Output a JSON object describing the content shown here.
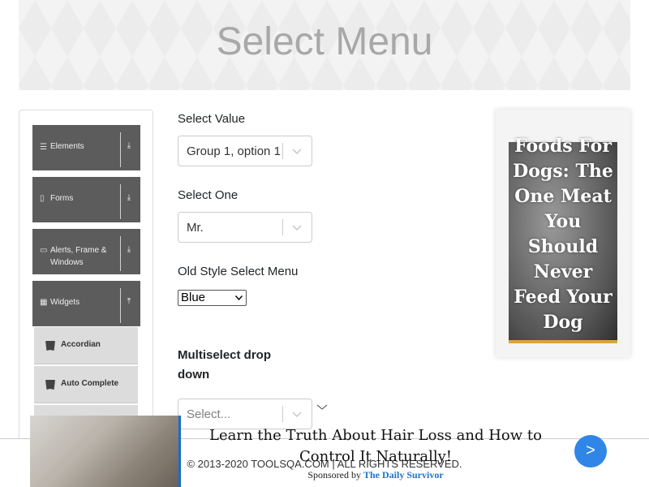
{
  "banner": {
    "title": "Select Menu"
  },
  "sidebar": {
    "groups": [
      {
        "label": "Elements",
        "icon": "list-icon",
        "arrow": "download-arrow-icon"
      },
      {
        "label": "Forms",
        "icon": "form-icon",
        "arrow": "download-arrow-icon"
      },
      {
        "label": "Alerts, Frame & Windows",
        "icon": "window-icon",
        "arrow": "download-arrow-icon"
      },
      {
        "label": "Widgets",
        "icon": "grid-icon",
        "arrow": "upload-arrow-icon"
      }
    ],
    "widgets_items": [
      {
        "label": "Accordian"
      },
      {
        "label": "Auto Complete"
      }
    ]
  },
  "main": {
    "select_value": {
      "label": "Select Value",
      "value": "Group 1, option 1"
    },
    "select_one": {
      "label": "Select One",
      "value": "Mr."
    },
    "old_style": {
      "label": "Old Style Select Menu",
      "value": "Blue"
    },
    "multiselect": {
      "label": "Multiselect drop down",
      "placeholder": "Select..."
    }
  },
  "ad_card": {
    "headline": "Foods For Dogs: The One Meat You Should Never Feed Your Dog"
  },
  "footer": {
    "copyright": "© 2013-2020 TOOLSQA.COM | ALL RIGHTS RESERVED."
  },
  "bottom_ad": {
    "title": "Learn the Truth About Hair Loss and How to Control It Naturally!",
    "sponsored_prefix": "Sponsored by",
    "sponsor": "The Daily Survivor",
    "next_label": ">"
  },
  "colors": {
    "sidebar_group_bg": "#5c5c5c",
    "sub_item_bg": "#dcdcdc",
    "next_button": "#2f86e6",
    "sponsor_link": "#1e73c8"
  }
}
